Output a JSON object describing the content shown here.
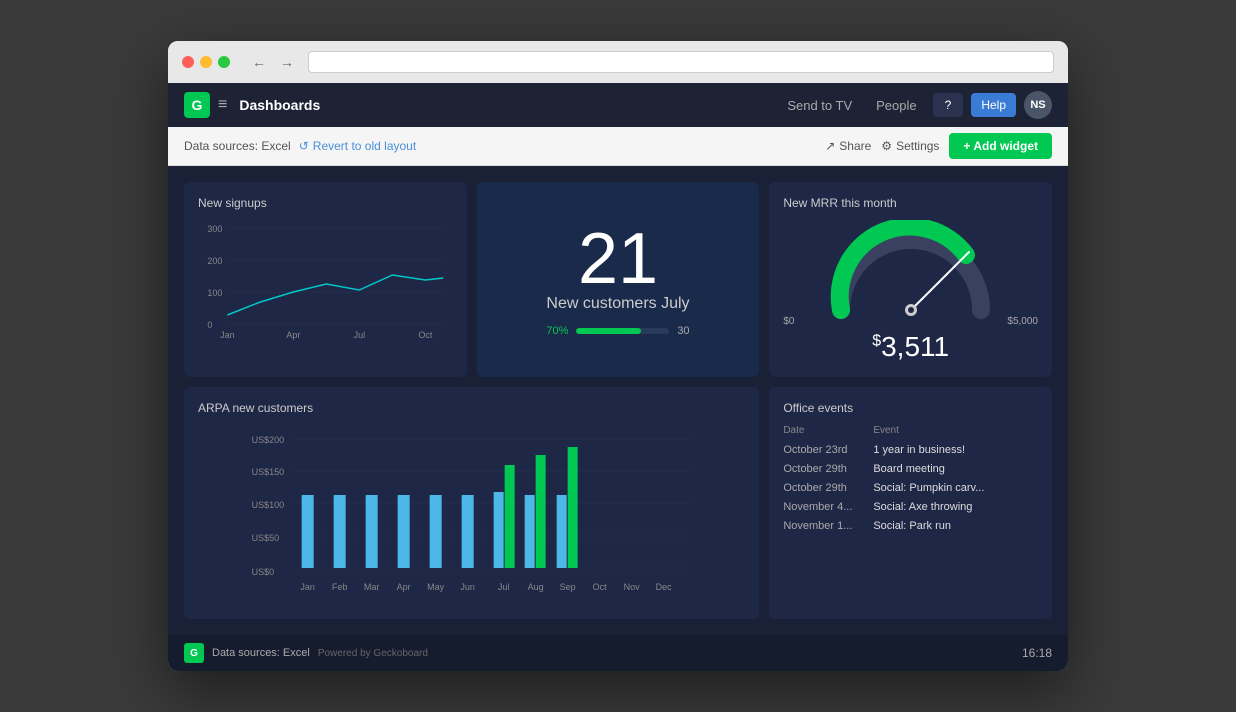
{
  "browser": {
    "back_icon": "←",
    "forward_icon": "→"
  },
  "header": {
    "logo_text": "G",
    "menu_icon": "≡",
    "title": "Dashboards",
    "send_to_tv": "Send to TV",
    "people": "People",
    "help_question": "?",
    "help": "Help",
    "avatar": "NS"
  },
  "toolbar": {
    "data_sources": "Data sources: Excel",
    "revert_icon": "↺",
    "revert_label": "Revert to old layout",
    "share_icon": "↗",
    "share_label": "Share",
    "settings_icon": "⚙",
    "settings_label": "Settings",
    "add_icon": "+",
    "add_label": "Add widget"
  },
  "widgets": {
    "signups": {
      "title": "New signups",
      "y_labels": [
        "300",
        "200",
        "100",
        "0"
      ],
      "x_labels": [
        "Jan",
        "Apr",
        "Jul",
        "Oct"
      ]
    },
    "customers": {
      "number": "21",
      "label": "New customers July",
      "progress_percent": 70,
      "progress_label": "70%",
      "target": "30"
    },
    "mrr": {
      "title": "New MRR this month",
      "min_label": "$0",
      "max_label": "$5,000",
      "currency": "$",
      "value": "3,511"
    },
    "arpa": {
      "title": "ARPA new customers",
      "y_labels": [
        "US$200",
        "US$150",
        "US$100",
        "US$50",
        "US$0"
      ],
      "x_labels": [
        "Jan",
        "Feb",
        "Mar",
        "Apr",
        "May",
        "Jun",
        "Jul",
        "Aug",
        "Sep",
        "Oct",
        "Nov",
        "Dec"
      ],
      "blue_bars": [
        100,
        100,
        100,
        100,
        100,
        100,
        105,
        100,
        100,
        0,
        0,
        0
      ],
      "green_bars": [
        0,
        0,
        0,
        0,
        0,
        0,
        140,
        155,
        165,
        0,
        0,
        0
      ]
    },
    "events": {
      "title": "Office events",
      "date_header": "Date",
      "event_header": "Event",
      "rows": [
        {
          "date": "October 23rd",
          "event": "1 year in business!"
        },
        {
          "date": "October 29th",
          "event": "Board meeting"
        },
        {
          "date": "October 29th",
          "event": "Social: Pumpkin carv..."
        },
        {
          "date": "November 4...",
          "event": "Social: Axe throwing"
        },
        {
          "date": "November 1...",
          "event": "Social: Park run"
        }
      ]
    }
  },
  "footer": {
    "logo_text": "G",
    "data_sources": "Data sources: Excel",
    "powered_by": "Powered by Geckoboard",
    "time": "16:18"
  }
}
